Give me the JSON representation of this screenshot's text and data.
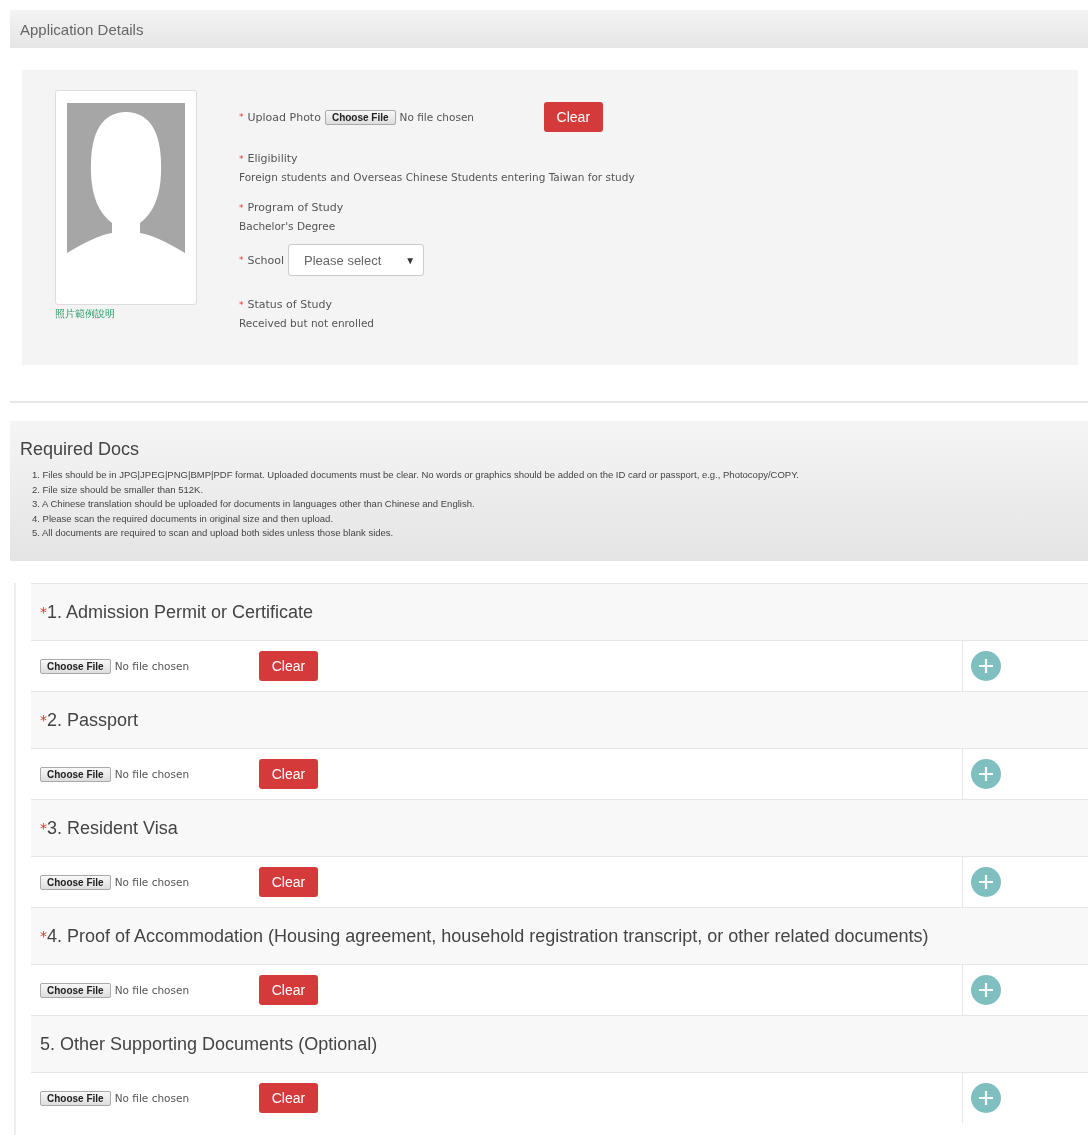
{
  "application": {
    "title": "Application Details",
    "photo_caption": "照片範例說明",
    "upload": {
      "label": "Upload Photo",
      "required_mark": "*",
      "choose": "Choose File",
      "status": "No file chosen",
      "clear": "Clear"
    },
    "fields": [
      {
        "kind": "text",
        "label": "Eligibility",
        "required_mark": "*",
        "value": "Foreign students and Overseas Chinese Students entering Taiwan for study"
      },
      {
        "kind": "text",
        "label": "Program of Study",
        "required_mark": "*",
        "value": "Bachelor's Degree"
      },
      {
        "kind": "select",
        "label": "School",
        "required_mark": "*",
        "placeholder": "Please select",
        "caret": "▼"
      },
      {
        "kind": "text",
        "label": "Status of Study",
        "required_mark": "*",
        "value": "Received but not enrolled"
      }
    ]
  },
  "required_docs": {
    "title": "Required Docs",
    "notes": [
      "1. Files should be in JPG|JPEG|PNG|BMP|PDF format. Uploaded documents must be clear. No words or graphics should be added on the ID card or passport, e.g., Photocopy/COPY.",
      "2. File size should be smaller than 512K.",
      "3. A Chinese translation should be uploaded for documents in languages other than Chinese and English.",
      "4. Please scan the required documents in original size and then upload.",
      "5. All documents are required to scan and upload both sides unless those blank sides."
    ]
  },
  "documents": [
    {
      "title": "1. Admission Permit or Certificate",
      "required_mark": "*",
      "choose": "Choose File",
      "status": "No file chosen",
      "clear": "Clear"
    },
    {
      "title": "2. Passport",
      "required_mark": "*",
      "choose": "Choose File",
      "status": "No file chosen",
      "clear": "Clear"
    },
    {
      "title": "3. Resident Visa",
      "required_mark": "*",
      "choose": "Choose File",
      "status": "No file chosen",
      "clear": "Clear"
    },
    {
      "title": "4. Proof of Accommodation (Housing agreement, household registration transcript, or other related documents)",
      "required_mark": "*",
      "choose": "Choose File",
      "status": "No file chosen",
      "clear": "Clear"
    },
    {
      "title": "5. Other Supporting Documents (Optional)",
      "choose": "Choose File",
      "status": "No file chosen",
      "clear": "Clear"
    }
  ]
}
